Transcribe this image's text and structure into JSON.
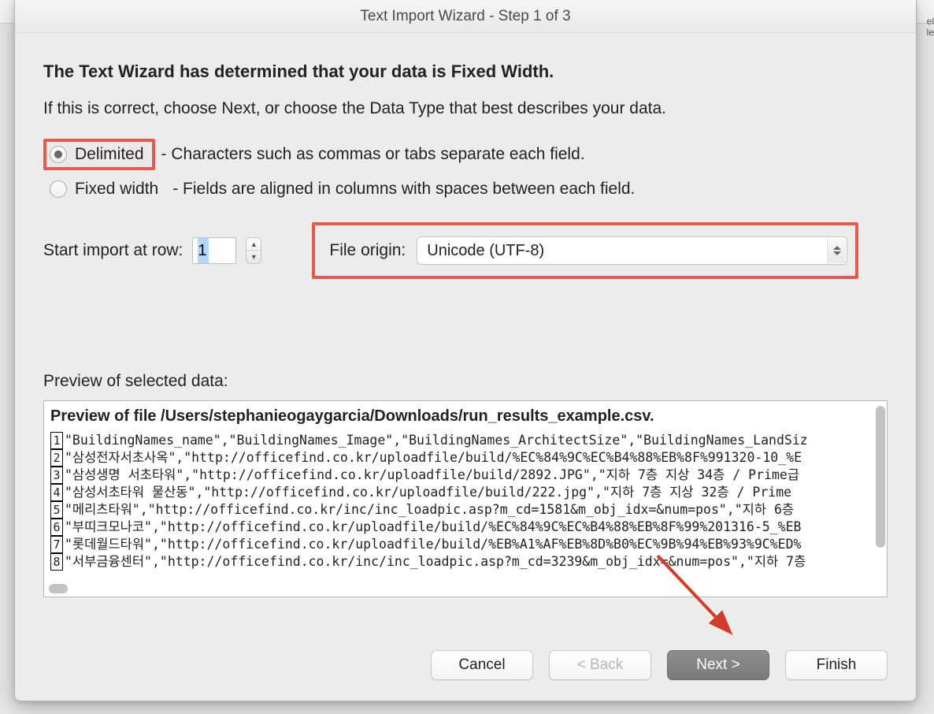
{
  "dialog": {
    "title": "Text Import Wizard - Step 1 of 3",
    "headline": "The Text Wizard has determined that your data is Fixed Width.",
    "intro": "If this is correct, choose Next, or choose the Data Type that best describes your data.",
    "radio_delimited": {
      "label": "Delimited",
      "desc": "- Characters such as commas or tabs separate each field."
    },
    "radio_fixed": {
      "label": "Fixed width",
      "desc": "- Fields are aligned in columns with spaces between each field."
    },
    "start_row_label": "Start import at row:",
    "start_row_value": "1",
    "file_origin_label": "File origin:",
    "file_origin_value": "Unicode (UTF-8)",
    "preview_label": "Preview of selected data:",
    "preview_title": "Preview of file /Users/stephanieogaygarcia/Downloads/run_results_example.csv.",
    "preview_rows": [
      {
        "n": "1",
        "t": "\"BuildingNames_name\",\"BuildingNames_Image\",\"BuildingNames_ArchitectSize\",\"BuildingNames_LandSiz"
      },
      {
        "n": "2",
        "t": "\"삼성전자서초사옥\",\"http://officefind.co.kr/uploadfile/build/%EC%84%9C%EC%B4%88%EB%8F%991320-10_%E"
      },
      {
        "n": "3",
        "t": "\"삼성생명 서초타워\",\"http://officefind.co.kr/uploadfile/build/2892.JPG\",\"지하 7층 지상 34층 / Prime급"
      },
      {
        "n": "4",
        "t": "\"삼성서초타워 물산동\",\"http://officefind.co.kr/uploadfile/build/222.jpg\",\"지하 7층 지상 32층 / Prime"
      },
      {
        "n": "5",
        "t": "\"메리츠타워\",\"http://officefind.co.kr/inc/inc_loadpic.asp?m_cd=1581&m_obj_idx=&num=pos\",\"지하 6층"
      },
      {
        "n": "6",
        "t": "\"부띠크모나코\",\"http://officefind.co.kr/uploadfile/build/%EC%84%9C%EC%B4%88%EB%8F%99%201316-5_%EB"
      },
      {
        "n": "7",
        "t": "\"롯데월드타워\",\"http://officefind.co.kr/uploadfile/build/%EB%A1%AF%EB%8D%B0%EC%9B%94%EB%93%9C%ED%"
      },
      {
        "n": "8",
        "t": "\"서부금융센터\",\"http://officefind.co.kr/inc/inc_loadpic.asp?m_cd=3239&m_obj_idx=&num=pos\",\"지하 7층"
      }
    ],
    "buttons": {
      "cancel": "Cancel",
      "back": "< Back",
      "next": "Next >",
      "finish": "Finish"
    }
  },
  "bg_right": "el\nle"
}
